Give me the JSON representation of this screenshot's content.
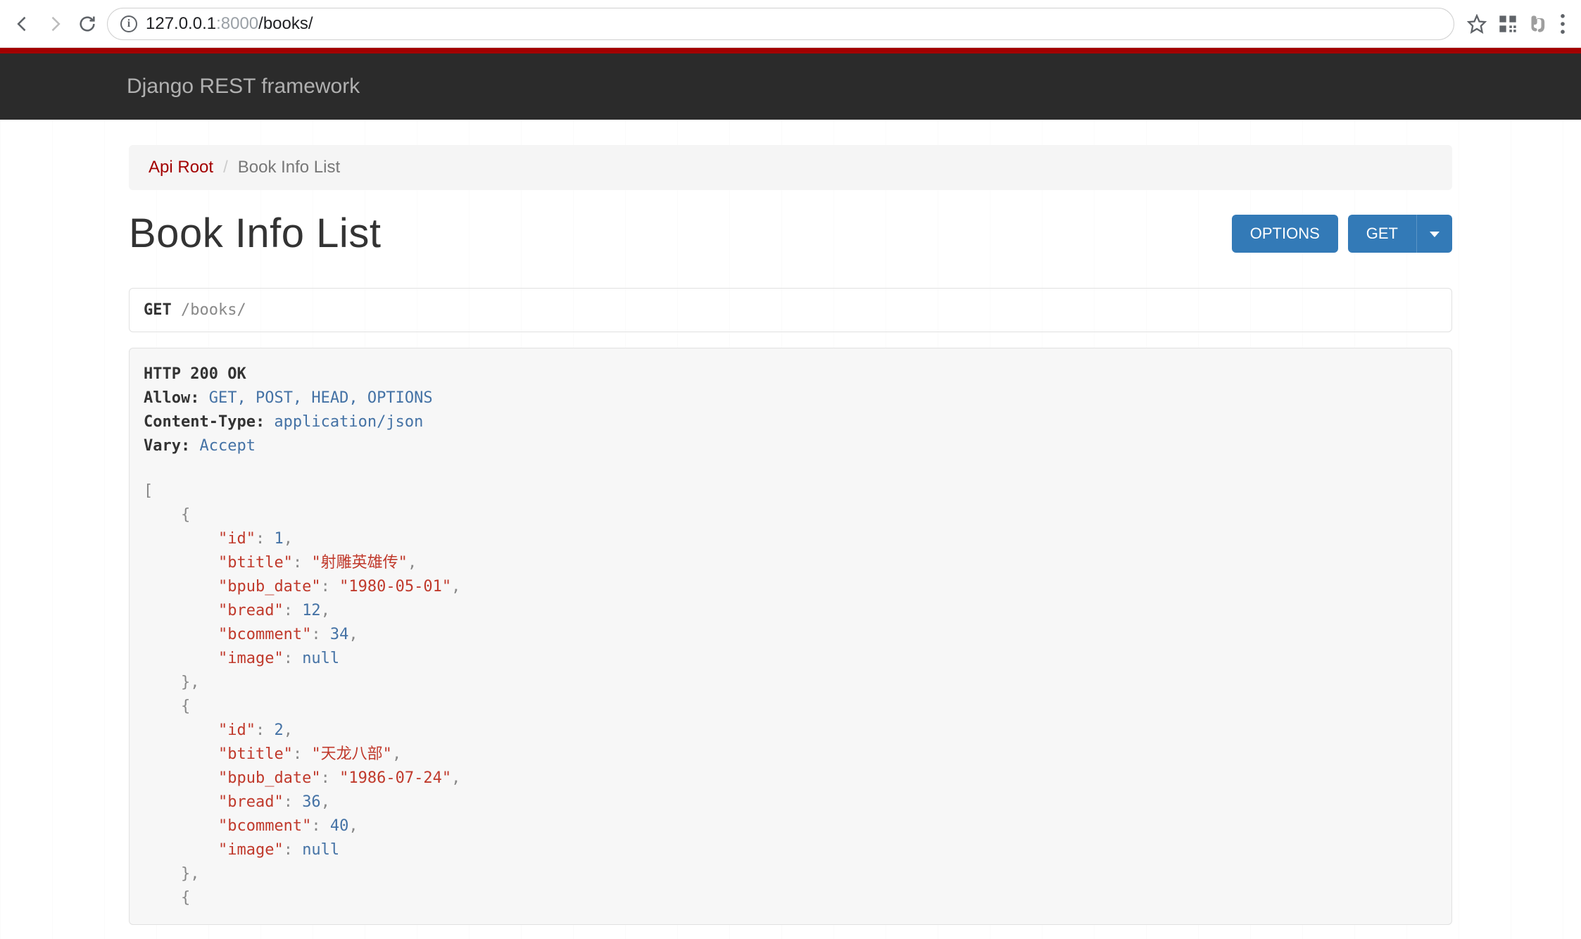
{
  "browser": {
    "url_host": "127.0.0.1",
    "url_port": ":8000",
    "url_path": "/books/"
  },
  "navbar": {
    "brand": "Django REST framework"
  },
  "breadcrumb": {
    "root": "Api Root",
    "sep": "/",
    "current": "Book Info List"
  },
  "title": "Book Info List",
  "buttons": {
    "options": "OPTIONS",
    "get": "GET"
  },
  "request": {
    "method": "GET",
    "path": " /books/"
  },
  "response": {
    "status": "HTTP 200 OK",
    "headers": [
      {
        "name": "Allow:",
        "value": " GET, POST, HEAD, OPTIONS"
      },
      {
        "name": "Content-Type:",
        "value": " application/json"
      },
      {
        "name": "Vary:",
        "value": " Accept"
      }
    ],
    "books": [
      {
        "id": 1,
        "btitle": "射雕英雄传",
        "bpub_date": "1980-05-01",
        "bread": 12,
        "bcomment": 34,
        "image": null
      },
      {
        "id": 2,
        "btitle": "天龙八部",
        "bpub_date": "1986-07-24",
        "bread": 36,
        "bcomment": 40,
        "image": null
      }
    ]
  }
}
